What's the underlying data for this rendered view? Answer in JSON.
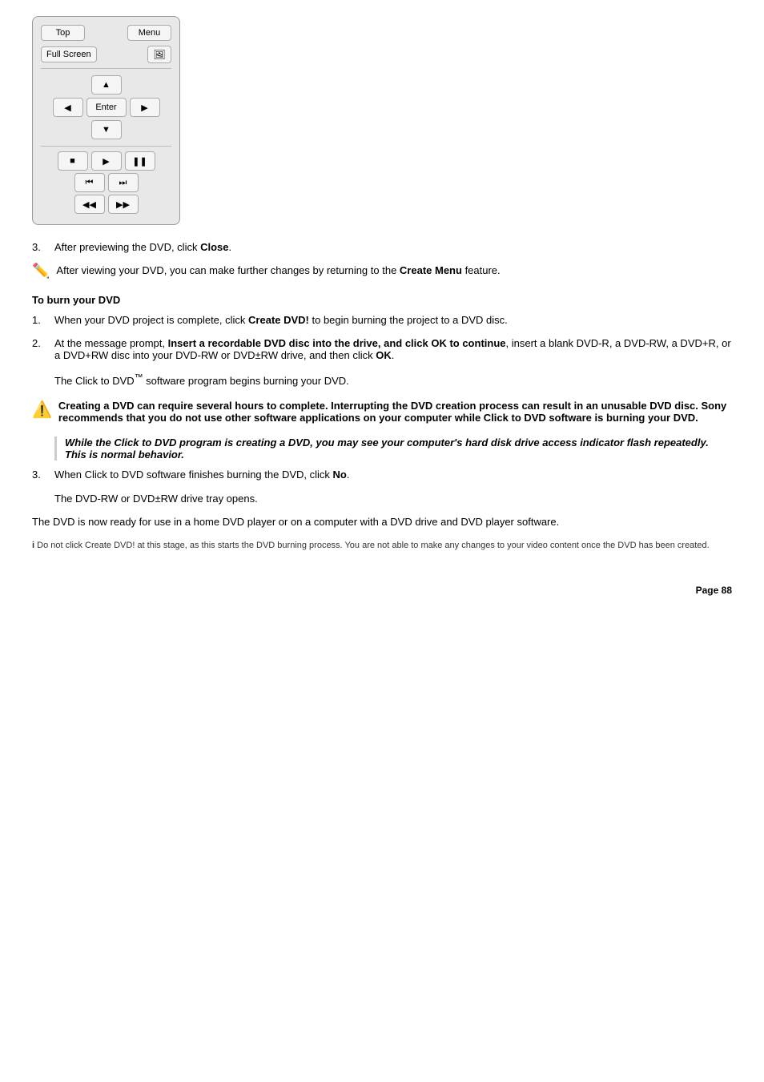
{
  "remote": {
    "btn_top": "Top",
    "btn_menu": "Menu",
    "btn_fullscreen": "Full Screen",
    "btn_up": "▲",
    "btn_left": "◀",
    "btn_enter": "Enter",
    "btn_right": "▶",
    "btn_down": "▼",
    "btn_stop": "■",
    "btn_play": "▶",
    "btn_pause": "❚❚",
    "btn_prev_chapter": "⏮",
    "btn_next_chapter": "⏭",
    "btn_rewind": "◀◀",
    "btn_fast_forward": "▶▶",
    "btn_screenshot": "🖼"
  },
  "step3_label": "3.",
  "step3_text": "After previewing the DVD, click ",
  "step3_bold": "Close",
  "step3_end": ".",
  "note_text": "After viewing your DVD, you can make further changes by returning to the ",
  "note_bold": "Create Menu",
  "note_end": " feature.",
  "section_title": "To burn your DVD",
  "burn_steps": [
    {
      "number": "1.",
      "text_before": "When your DVD project is complete, click ",
      "bold": "Create DVD!",
      "text_after": " to begin burning the project to a DVD disc."
    },
    {
      "number": "2.",
      "text_before": "At the message prompt, ",
      "bold": "Insert a recordable DVD disc into the drive, and click OK to continue",
      "text_after": ", insert a blank DVD-R, a DVD-RW, a DVD+R, or a DVD+RW disc into your DVD-RW or DVD±RW drive, and then click ",
      "bold2": "OK",
      "text_after2": "."
    }
  ],
  "burn_step2_sub": "The Click to DVD™ software program begins burning your DVD.",
  "warning_text": "Creating a DVD can require several hours to complete. Interrupting the DVD creation process can result in an unusable DVD disc. Sony recommends that you do not use other software applications on your computer while Click to DVD software is burning your DVD.",
  "info_indented": "While the Click to DVD program is creating a DVD, you may see your computer's hard disk drive access indicator flash repeatedly. This is normal behavior.",
  "burn_step3_label": "3.",
  "burn_step3_text": "When Click to DVD software finishes burning the DVD, click ",
  "burn_step3_bold": "No",
  "burn_step3_end": ".",
  "burn_step3_sub": "The DVD-RW or DVD±RW drive tray opens.",
  "final_text": "The DVD is now ready for use in a home DVD player or on a computer with a DVD drive and DVD player software.",
  "small_note": "Do not click Create DVD! at this stage, as this starts the DVD burning process. You are not able to make any changes to your video content once the DVD has been created.",
  "page_number": "Page 88"
}
